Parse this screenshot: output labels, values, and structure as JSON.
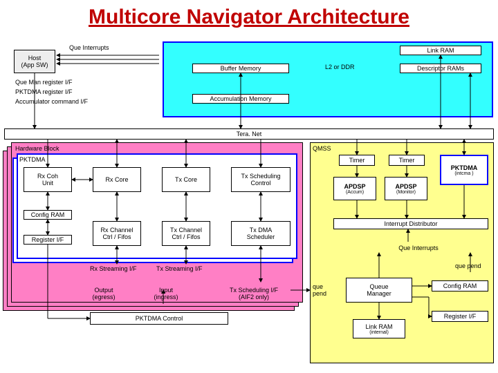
{
  "title": "Multicore Navigator Architecture",
  "top": {
    "host": "Host\n(App SW)",
    "que_interrupts": "Que Interrupts",
    "link_ram": "Link RAM",
    "buffer_memory": "Buffer Memory",
    "l2_or_ddr": "L2 or DDR",
    "descriptor_rams": "Descriptor RAMs",
    "que_man": "Que Man register I/F",
    "pktdma_reg": "PKTDMA register I/F",
    "accum_cmd": "Accumulator command I/F",
    "accum_mem": "Accumulation Memory"
  },
  "bus": "Tera. Net",
  "hw": {
    "title": "Hardware Block",
    "pktdma": "PKTDMA",
    "rx_coh": "Rx Coh\nUnit",
    "rx_core": "Rx Core",
    "tx_core": "Tx Core",
    "tx_sched_ctrl": "Tx Scheduling\nControl",
    "config_ram": "Config RAM",
    "register_if": "Register I/F",
    "rx_ch": "Rx Channel\nCtrl / Fifos",
    "tx_ch": "Tx Channel\nCtrl / Fifos",
    "tx_dma_sched": "Tx DMA\nScheduler",
    "rx_stream": "Rx Streaming I/F",
    "tx_stream": "Tx Streaming I/F",
    "output_egress": "Output\n(egress)",
    "input_ingress": "Input\n(ingress)",
    "tx_sched_if": "Tx Scheduling I/F\n(AIF2 only)",
    "pktdma_control": "PKTDMA Control"
  },
  "qmss": {
    "title": "QMSS",
    "timer1": "Timer",
    "timer2": "Timer",
    "pktdma": "PKTDMA",
    "pktdma_sub": "(intcma )",
    "apdsp1": "APDSP",
    "apdsp1_sub": "(Accum)",
    "apdsp2": "APDSP",
    "apdsp2_sub": "(Monitor)",
    "int_dist": "Interrupt Distributor",
    "que_interrupts": "Que Interrupts",
    "que_pend1": "que pend",
    "que_pend2": "que\npend",
    "queue_manager": "Queue\nManager",
    "config_ram": "Config RAM",
    "link_ram": "Link RAM",
    "link_ram_sub": "(internal)",
    "register_if": "Register I/F"
  }
}
